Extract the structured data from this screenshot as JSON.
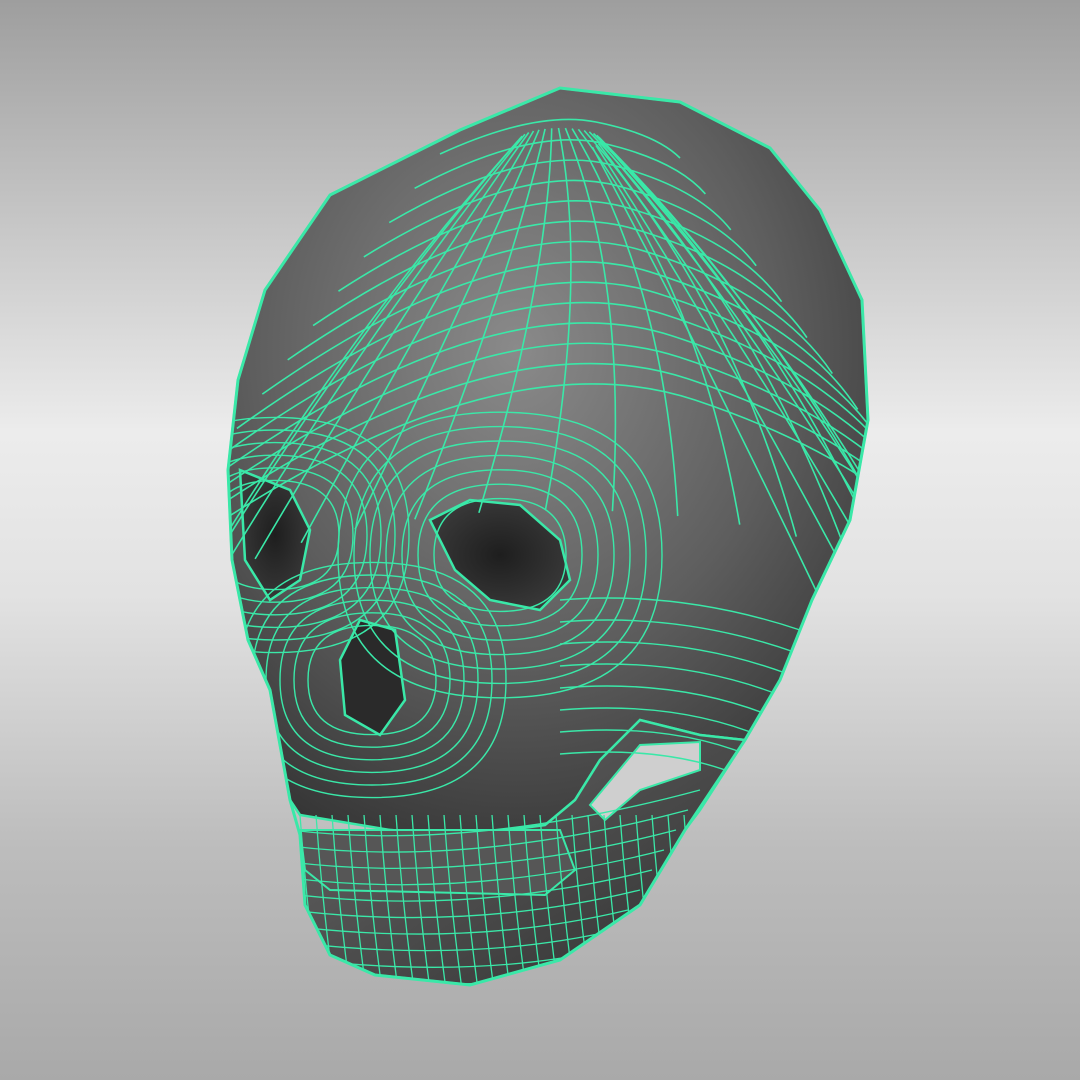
{
  "viewport": {
    "background": "gradient-grey",
    "object": "skull-mesh",
    "display_mode": "shaded-with-wireframe"
  },
  "colors": {
    "bg_top": "#9e9e9e",
    "bg_mid": "#ececec",
    "bg_bottom": "#a9a9a9",
    "mesh_fill": "#5d5d5d",
    "mesh_shadow": "#2e2e2e",
    "mesh_highlight": "#8a8a8a",
    "wire": "#3ae8a8"
  }
}
